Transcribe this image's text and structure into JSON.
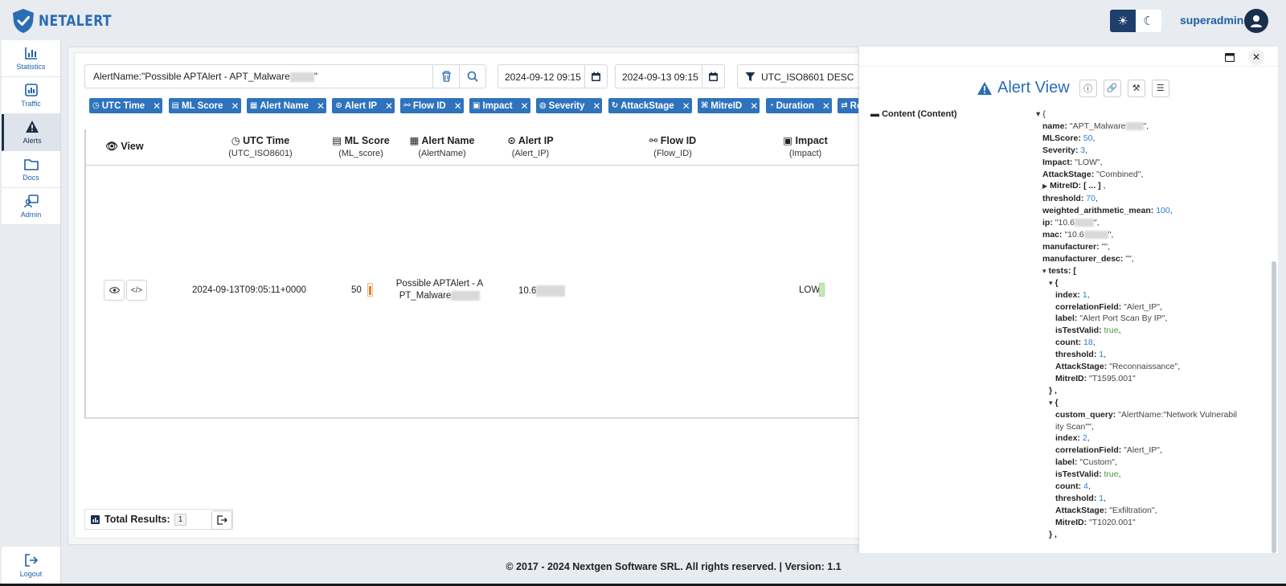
{
  "app": {
    "name": "NETALERT",
    "username": "superadmin"
  },
  "sidebar": {
    "items": [
      {
        "label": "Statistics"
      },
      {
        "label": "Traffic"
      },
      {
        "label": "Alerts"
      },
      {
        "label": "Docs"
      },
      {
        "label": "Admin"
      }
    ],
    "logout": "Logout"
  },
  "search": {
    "query_prefix": "AlertName:\"Possible APTAlert - APT_Malware",
    "query_suffix": "\""
  },
  "dates": {
    "from": "2024-09-12 09:15",
    "to": "2024-09-13 09:15"
  },
  "sort": {
    "value": "UTC_ISO8601 DESC"
  },
  "chips": [
    {
      "label": "UTC Time",
      "icon": "clock-icon"
    },
    {
      "label": "ML Score",
      "icon": "score-icon"
    },
    {
      "label": "Alert Name",
      "icon": "doc-icon"
    },
    {
      "label": "Alert IP",
      "icon": "pin-icon"
    },
    {
      "label": "Flow ID",
      "icon": "flow-icon"
    },
    {
      "label": "Impact",
      "icon": "impact-icon"
    },
    {
      "label": "Severity",
      "icon": "severity-icon"
    },
    {
      "label": "AttackStage",
      "icon": "cycle-icon"
    },
    {
      "label": "MitreID",
      "icon": "mitre-icon"
    },
    {
      "label": "Duration",
      "icon": "timer-icon"
    },
    {
      "label": "Re",
      "icon": "repeat-icon"
    }
  ],
  "table": {
    "headers": [
      {
        "title": "View",
        "sub": ""
      },
      {
        "title": "UTC Time",
        "sub": "(UTC_ISO8601)"
      },
      {
        "title": "ML Score",
        "sub": "(ML_score)"
      },
      {
        "title": "Alert Name",
        "sub": "(AlertName)"
      },
      {
        "title": "Alert IP",
        "sub": "(Alert_IP)"
      },
      {
        "title": "Flow ID",
        "sub": "(Flow_ID)"
      },
      {
        "title": "Impact",
        "sub": "(Impact)"
      }
    ],
    "row": {
      "time": "2024-09-13T09:05:11+0000",
      "ml_score": "50",
      "alert_name_1": "Possible APTAlert - A",
      "alert_name_2": "PT_Malware",
      "alert_ip": "10.6",
      "impact": "LOW"
    },
    "total_label": "Total Results:",
    "total_count": "1"
  },
  "detail": {
    "title": "Alert View",
    "content_label": "Content (Content)",
    "json": {
      "name": "\"APT_Malware",
      "MLScore": "50",
      "Severity": "3",
      "Impact": "\"LOW\"",
      "AttackStage": "\"Combined\"",
      "MitreID": "[ ... ]",
      "threshold": "70",
      "weighted_arithmetic_mean": "100",
      "ip": "\"10.6",
      "mac": "\"10.6",
      "manufacturer": "\"\"",
      "manufacturer_desc": "\"\"",
      "t1_index": "1",
      "t1_correlationField": "\"Alert_IP\"",
      "t1_label": "\"Alert Port Scan By IP\"",
      "t1_isTestValid": "true",
      "t1_count": "18",
      "t1_threshold": "1",
      "t1_AttackStage": "\"Reconnaissance\"",
      "t1_MitreID": "\"T1595.001\"",
      "t2_custom_query_1": "\"AlertName:\"Network Vulnerabil",
      "t2_custom_query_2": "ity Scan\"\"",
      "t2_index": "2",
      "t2_correlationField": "\"Alert_IP\"",
      "t2_label": "\"Custom\"",
      "t2_isTestValid": "true",
      "t2_count": "4",
      "t2_threshold": "1",
      "t2_AttackStage": "\"Exfiltration\"",
      "t2_MitreID": "\"T1020.001\""
    }
  },
  "footer": "© 2017 - 2024 Nextgen Software SRL. All rights reserved. | Version: 1.1"
}
